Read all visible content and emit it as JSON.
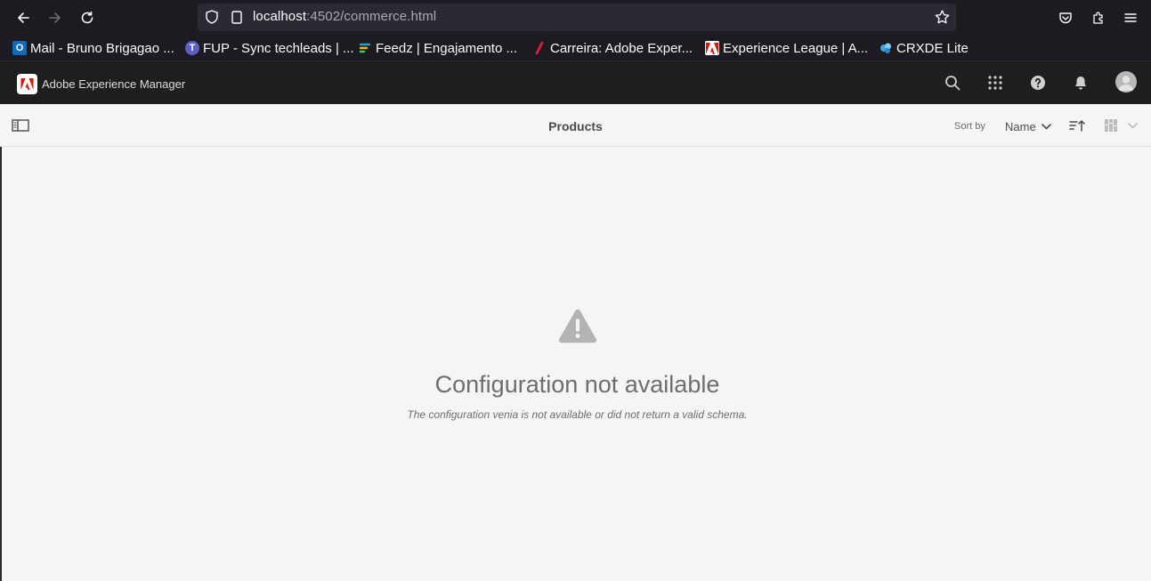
{
  "browser": {
    "url_host": "localhost",
    "url_rest": ":4502/commerce.html",
    "bookmarks": [
      {
        "label": "Mail - Bruno Brigagao ..."
      },
      {
        "label": "FUP - Sync techleads | ..."
      },
      {
        "label": "Feedz | Engajamento ..."
      },
      {
        "label": "Carreira: Adobe Exper..."
      },
      {
        "label": "Experience League | A..."
      },
      {
        "label": "CRXDE Lite"
      }
    ]
  },
  "aem": {
    "title": "Adobe Experience Manager"
  },
  "action_bar": {
    "title": "Products",
    "sort_label": "Sort by",
    "sort_value": "Name"
  },
  "empty_state": {
    "title": "Configuration not available",
    "description": "The configuration venia is not available or did not return a valid schema."
  },
  "colors": {
    "browser_bg": "#1c1b22",
    "urlbar_bg": "#2b2a33",
    "aem_header_bg": "#1e1e1e",
    "content_bg": "#f5f5f5",
    "adobe_red": "#eb1000"
  }
}
